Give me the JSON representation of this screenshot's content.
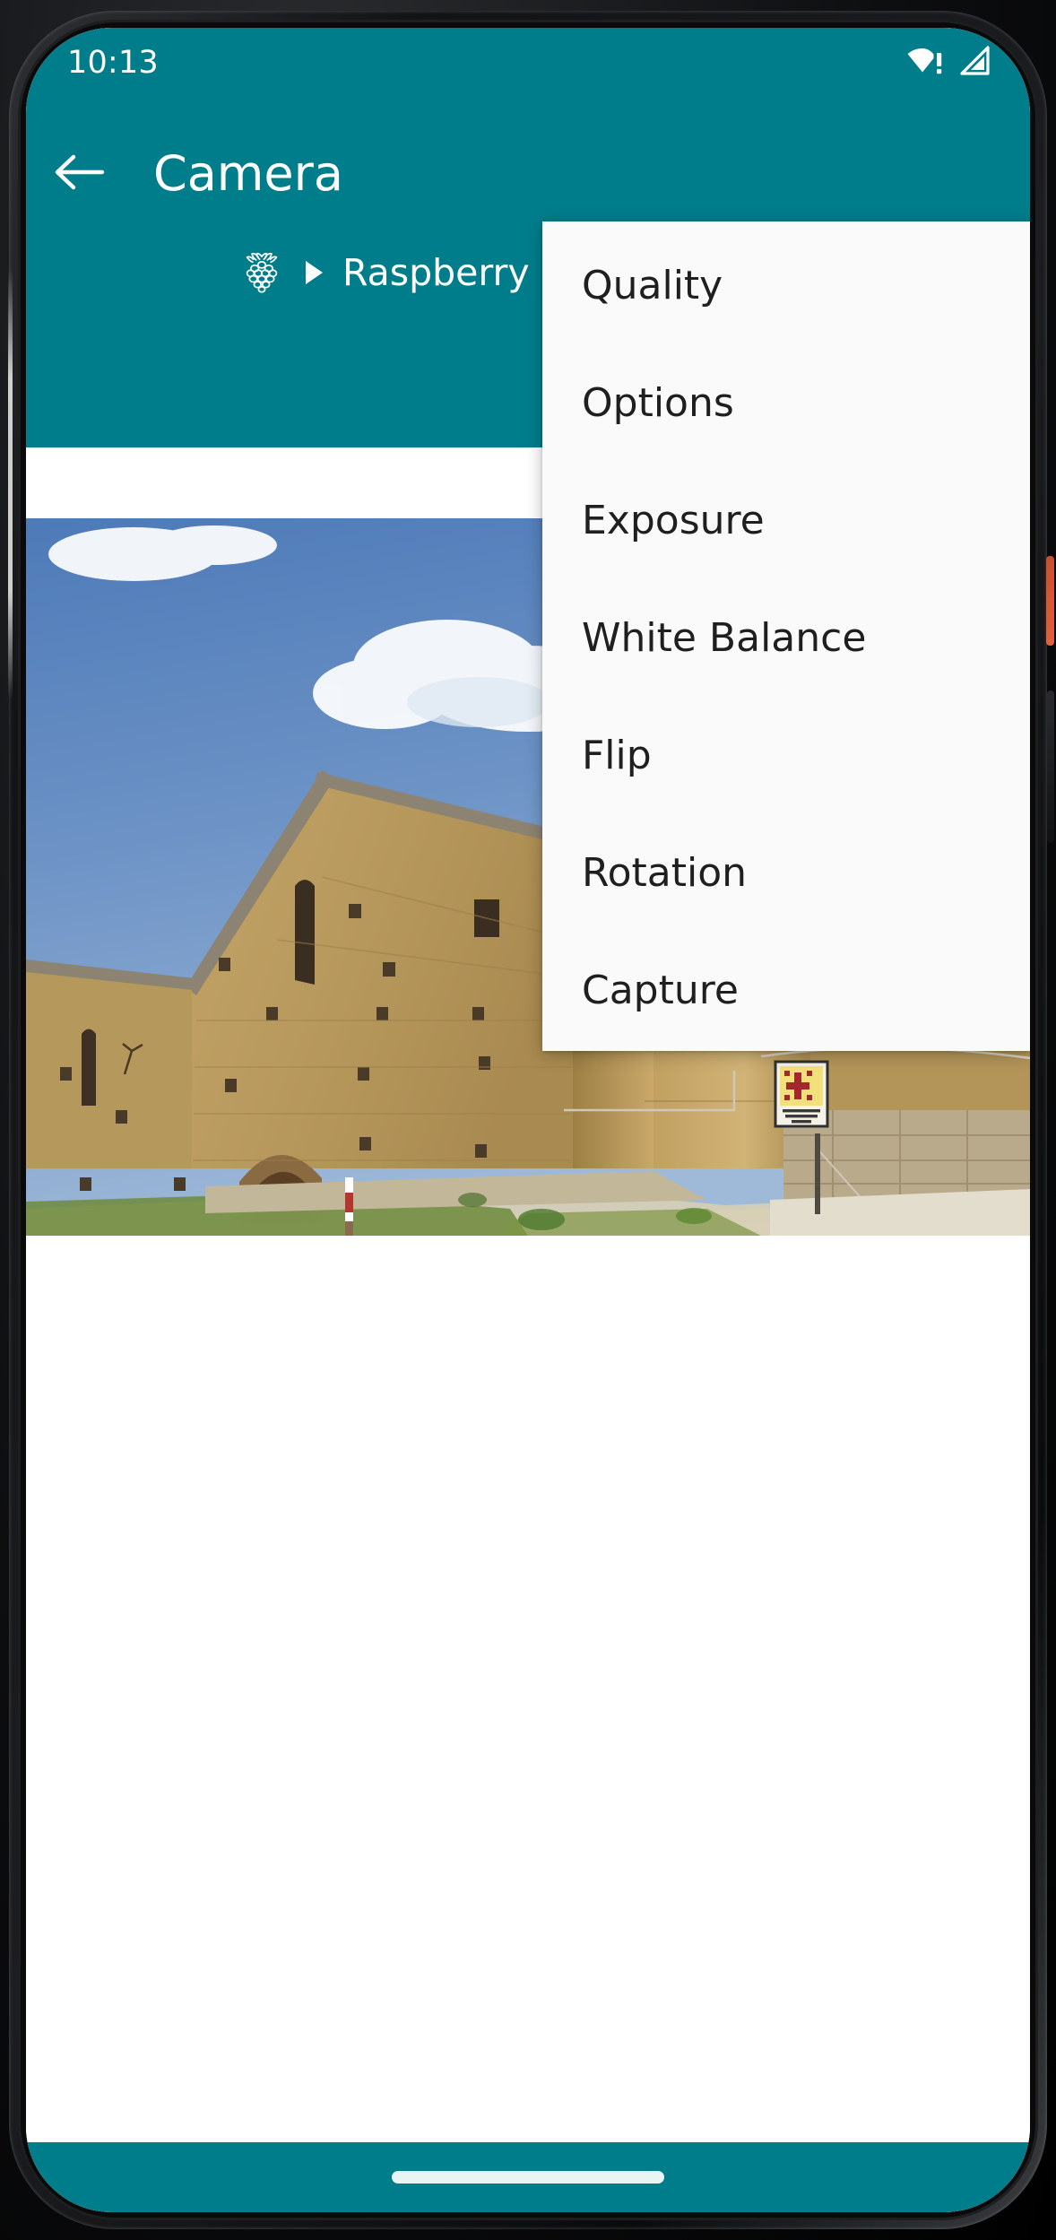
{
  "device": {
    "camera_icon": "front-camera-lens",
    "sensor_icon": "proximity-sensor",
    "speaker_icon": "earpiece-speaker"
  },
  "status_bar": {
    "time": "10:13",
    "icons": [
      {
        "name": "wifi-no-internet-icon",
        "label": "Wi-Fi (no internet)"
      },
      {
        "name": "cellular-signal-icon",
        "label": "Cellular signal"
      }
    ]
  },
  "app_bar": {
    "back_icon": "back-arrow-icon",
    "title": "Camera",
    "breadcrumb": {
      "logo_icon": "raspberry-pi-logo-icon",
      "separator_icon": "caret-right-icon",
      "text": "Raspberry Pi"
    },
    "background_color": "#007D8A"
  },
  "menu": {
    "items": [
      {
        "label": "Quality"
      },
      {
        "label": "Options"
      },
      {
        "label": "Exposure"
      },
      {
        "label": "White Balance"
      },
      {
        "label": "Flip"
      },
      {
        "label": "Rotation"
      },
      {
        "label": "Capture"
      }
    ],
    "background_color": "#FAFAFA",
    "text_color": "#1F1F1F"
  },
  "preview": {
    "name": "camera-preview-image",
    "alt": "Stone medieval church with bell tower under blue sky with clouds",
    "sign_lines": [
      "GRAN PRIORATO",
      "DI S.ANDREA",
      "XII SEC."
    ]
  },
  "system_nav": {
    "pill_icon": "gesture-home-pill"
  }
}
